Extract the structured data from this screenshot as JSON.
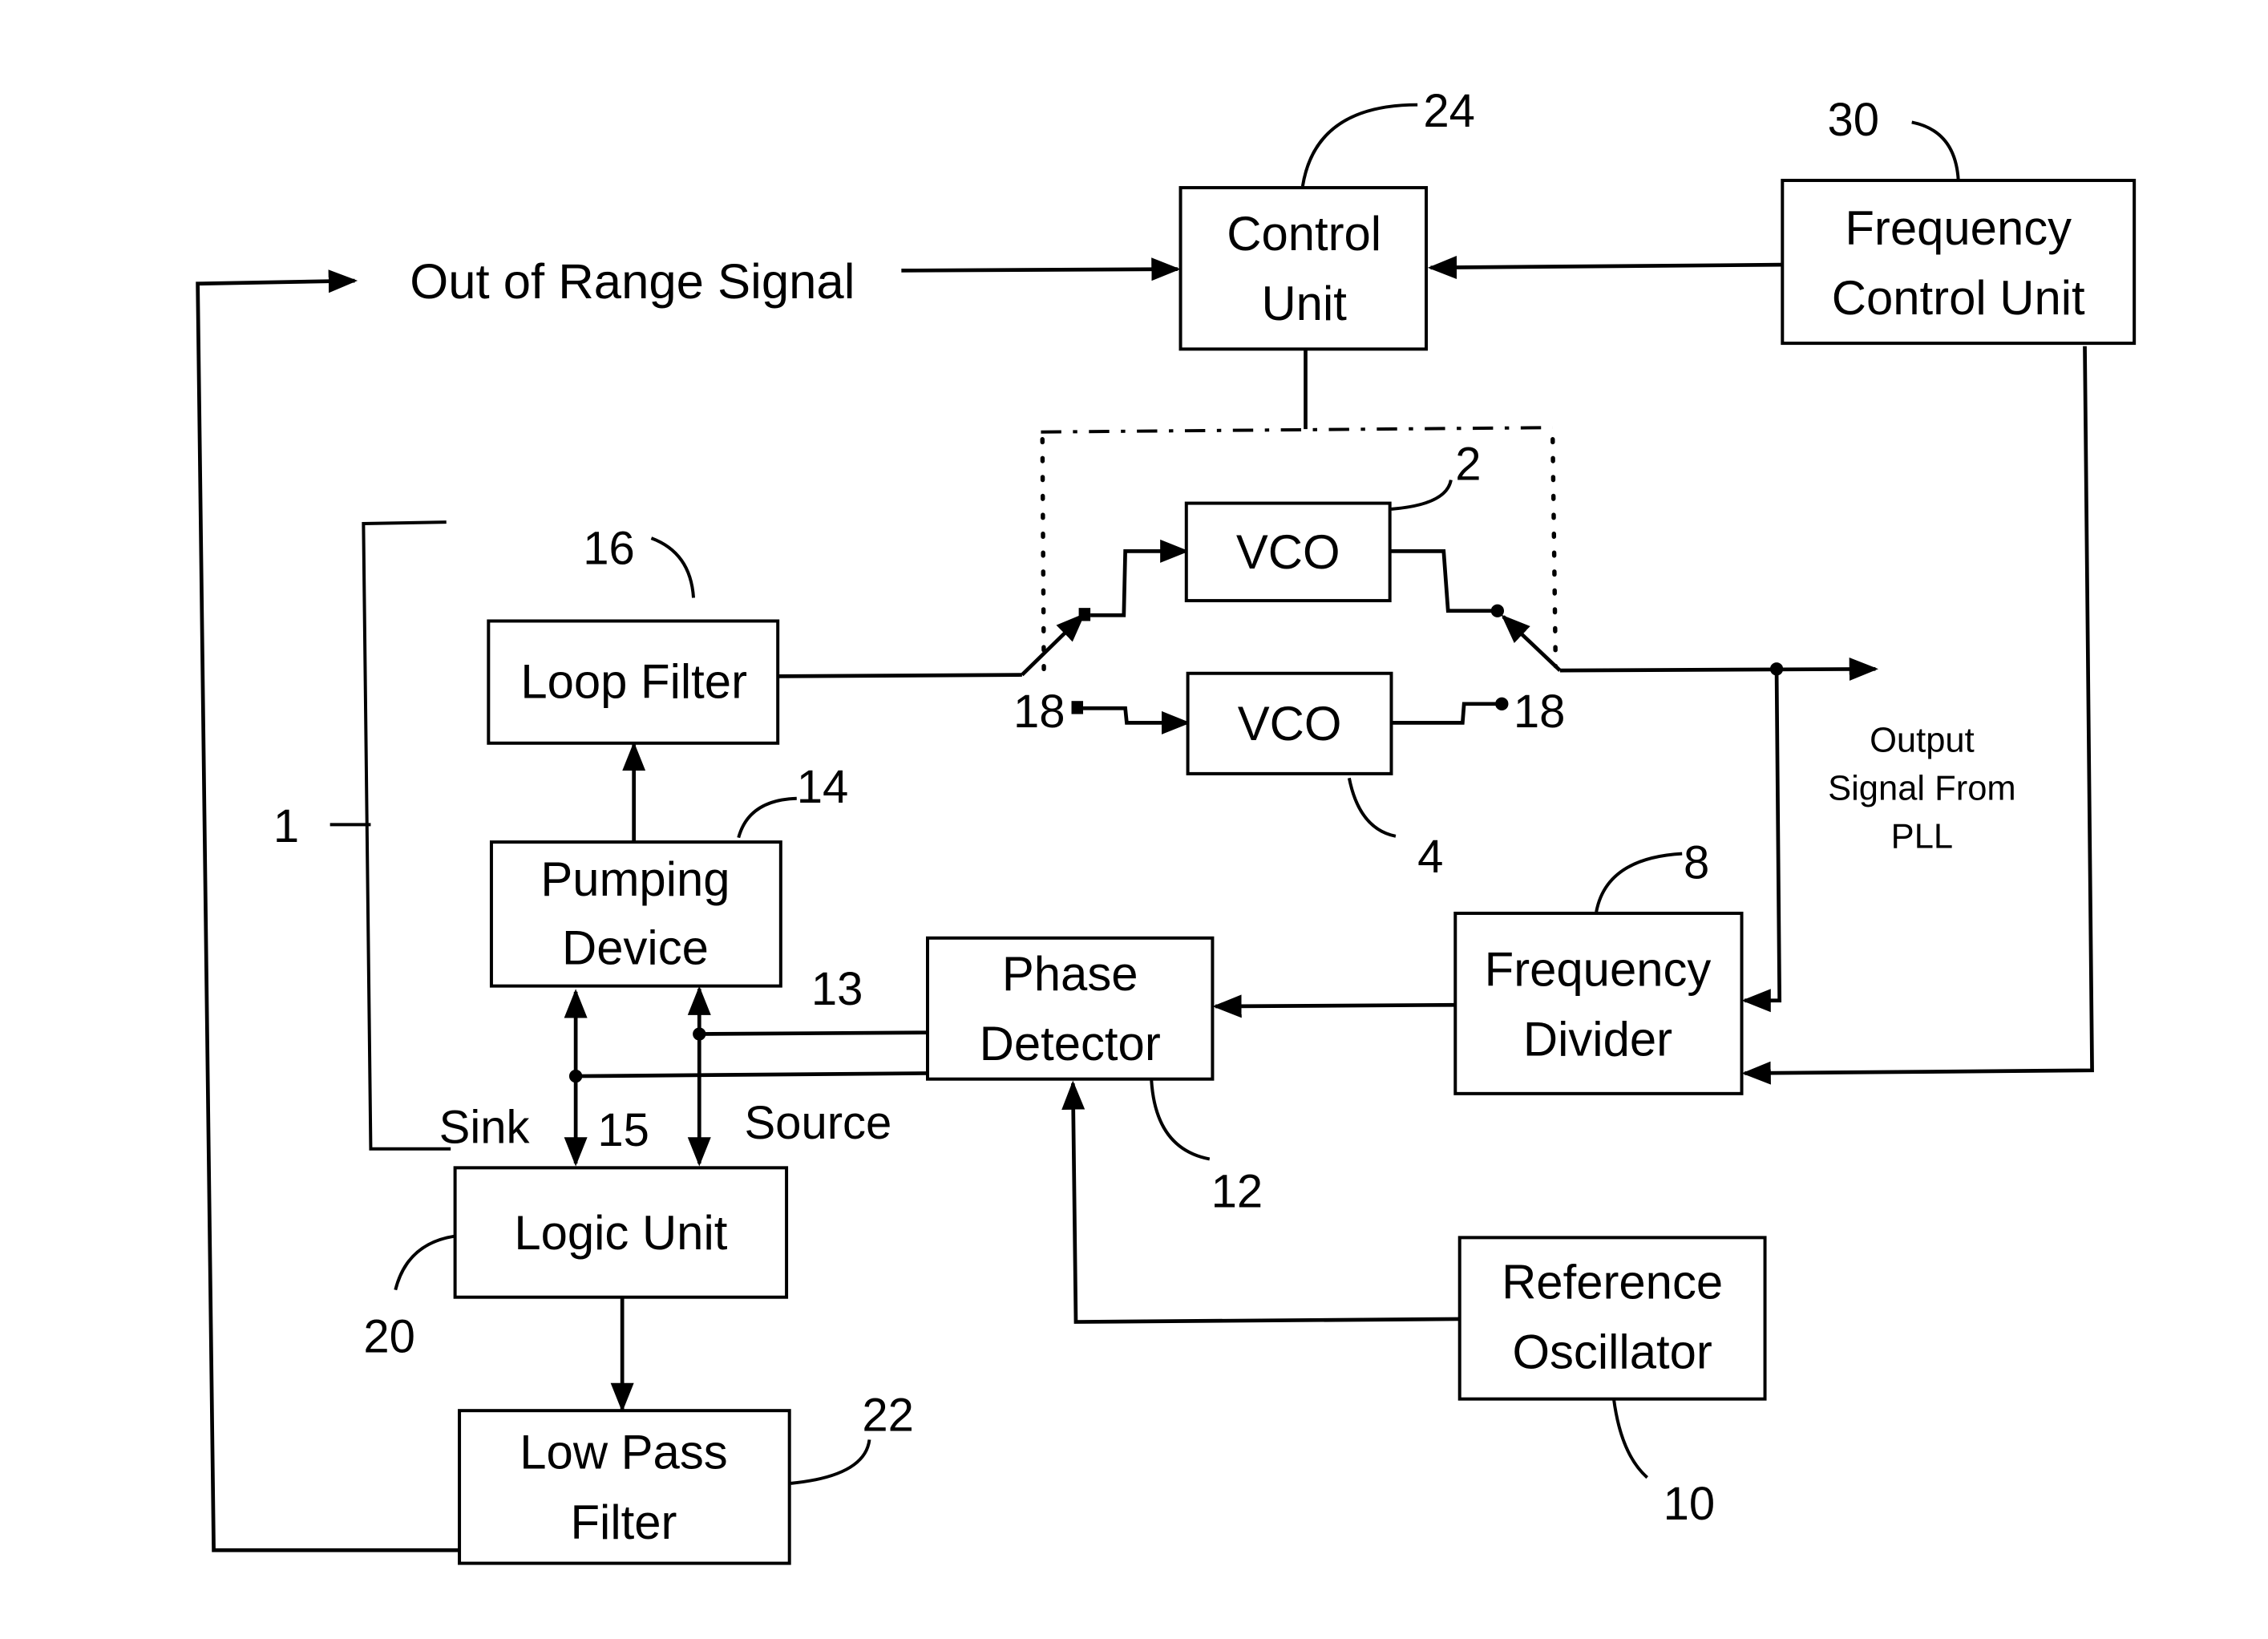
{
  "diagram": {
    "type": "block-diagram",
    "subject": "PLL with switchable VCOs",
    "blocks": {
      "control_unit": {
        "lines": [
          "Control",
          "Unit"
        ],
        "ref": "24"
      },
      "frequency_control_unit": {
        "lines": [
          "Frequency",
          "Control Unit"
        ],
        "ref": "30"
      },
      "vco_top": {
        "lines": [
          "VCO"
        ],
        "ref": "2"
      },
      "vco_bottom": {
        "lines": [
          "VCO"
        ],
        "ref": "4"
      },
      "loop_filter": {
        "lines": [
          "Loop Filter"
        ],
        "ref": "16"
      },
      "pumping_device": {
        "lines": [
          "Pumping",
          "Device"
        ],
        "ref": "14"
      },
      "phase_detector": {
        "lines": [
          "Phase",
          "Detector"
        ],
        "ref": "12"
      },
      "frequency_divider": {
        "lines": [
          "Frequency",
          "Divider"
        ],
        "ref": "8"
      },
      "logic_unit": {
        "lines": [
          "Logic Unit"
        ],
        "ref": "20"
      },
      "low_pass_filter": {
        "lines": [
          "Low Pass",
          "Filter"
        ],
        "ref": "22"
      },
      "reference_oscillator": {
        "lines": [
          "Reference",
          "Oscillator"
        ],
        "ref": "10"
      }
    },
    "labels": {
      "out_of_range": "Out of Range Signal",
      "output_signal": [
        "Output",
        "Signal From",
        "PLL"
      ],
      "sink": "Sink",
      "source": "Source",
      "ref_1": "1",
      "ref_13": "13",
      "ref_15": "15",
      "switch_left": "18",
      "switch_right": "18"
    }
  }
}
